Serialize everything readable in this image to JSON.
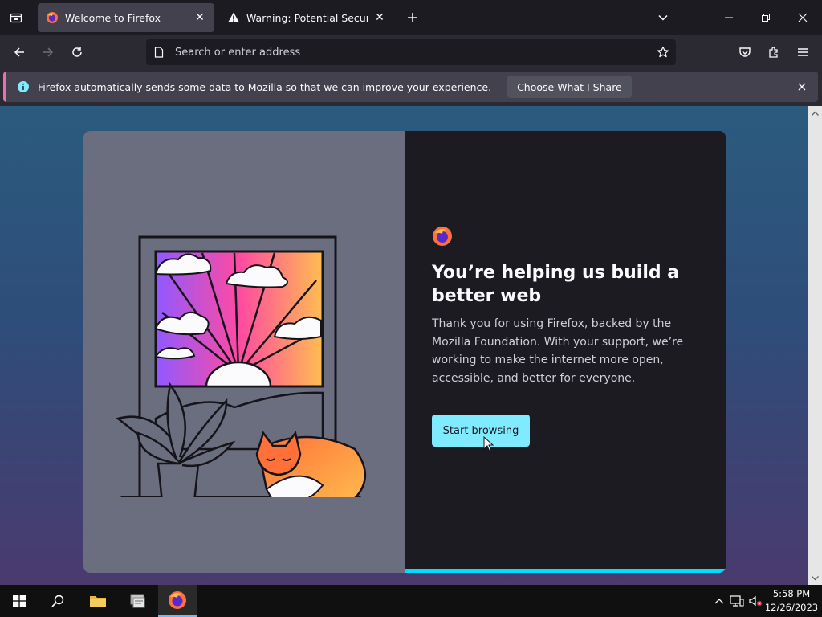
{
  "tabs": [
    {
      "title": "Welcome to Firefox",
      "active": true,
      "icon": "firefox-icon"
    },
    {
      "title": "Warning: Potential Security Risk Ahead",
      "active": false,
      "icon": "warning-icon"
    }
  ],
  "urlbar": {
    "placeholder": "Search or enter address"
  },
  "notification": {
    "message": "Firefox automatically sends some data to Mozilla so that we can improve your experience.",
    "button": "Choose What I Share"
  },
  "welcome": {
    "heading": "You’re helping us build a better web",
    "body": "Thank you for using Firefox, backed by the Mozilla Foundation. With your support, we’re working to make the internet more open, accessible, and better for everyone.",
    "button": "Start browsing",
    "progress_fraction": 1.0
  },
  "taskbar": {
    "time": "5:58 PM",
    "date": "12/26/2023"
  },
  "colors": {
    "accent": "#00ddff",
    "button": "#80ebff",
    "notification_border": "#e86fb3"
  }
}
